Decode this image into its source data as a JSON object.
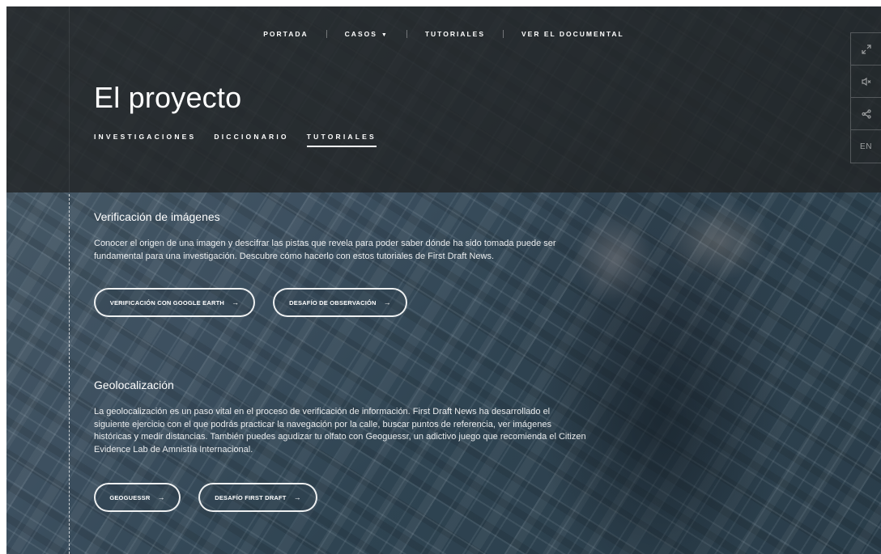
{
  "topnav": {
    "items": [
      {
        "label": "PORTADA"
      },
      {
        "label": "CASOS"
      },
      {
        "label": "TUTORIALES"
      },
      {
        "label": "VER EL DOCUMENTAL"
      }
    ]
  },
  "page": {
    "title": "El proyecto"
  },
  "subnav": {
    "items": [
      {
        "label": "INVESTIGACIONES"
      },
      {
        "label": "DICCIONARIO"
      },
      {
        "label": "TUTORIALES",
        "active": true
      }
    ]
  },
  "side_tools": {
    "icons": [
      "expand-icon",
      "speaker-icon",
      "share-icon"
    ],
    "language": "EN"
  },
  "sections": [
    {
      "title": "Verificación de imágenes",
      "body": "Conocer el origen de una imagen y descifrar las pistas que revela para poder saber dónde ha sido tomada puede ser fundamental para una investigación. Descubre cómo hacerlo con estos tutoriales de First Draft News.",
      "buttons": [
        {
          "label": "VERIFICACIÓN CON GOOGLE EARTH",
          "arrow": "→"
        },
        {
          "label": "DESAFÍO DE OBSERVACIÓN",
          "arrow": "→"
        }
      ]
    },
    {
      "title": "Geolocalización",
      "body": "La geolocalización es un paso vital en el proceso de verificación de información. First Draft News ha desarrollado el siguiente ejercicio con el que podrás practicar la navegación por la calle, buscar puntos de referencia, ver imágenes históricas y medir distancias. También puedes agudizar tu olfato con Geoguessr, un adictivo juego que recomienda el Citizen Evidence Lab de Amnistía Internacional.",
      "buttons": [
        {
          "label": "GEOGUESSR",
          "arrow": "→"
        },
        {
          "label": "DESAFÍO FIRST DRAFT",
          "arrow": "→"
        }
      ]
    }
  ],
  "colors": {
    "header_overlay": "#222426",
    "background": "#3d5060",
    "text": "#ffffff"
  }
}
